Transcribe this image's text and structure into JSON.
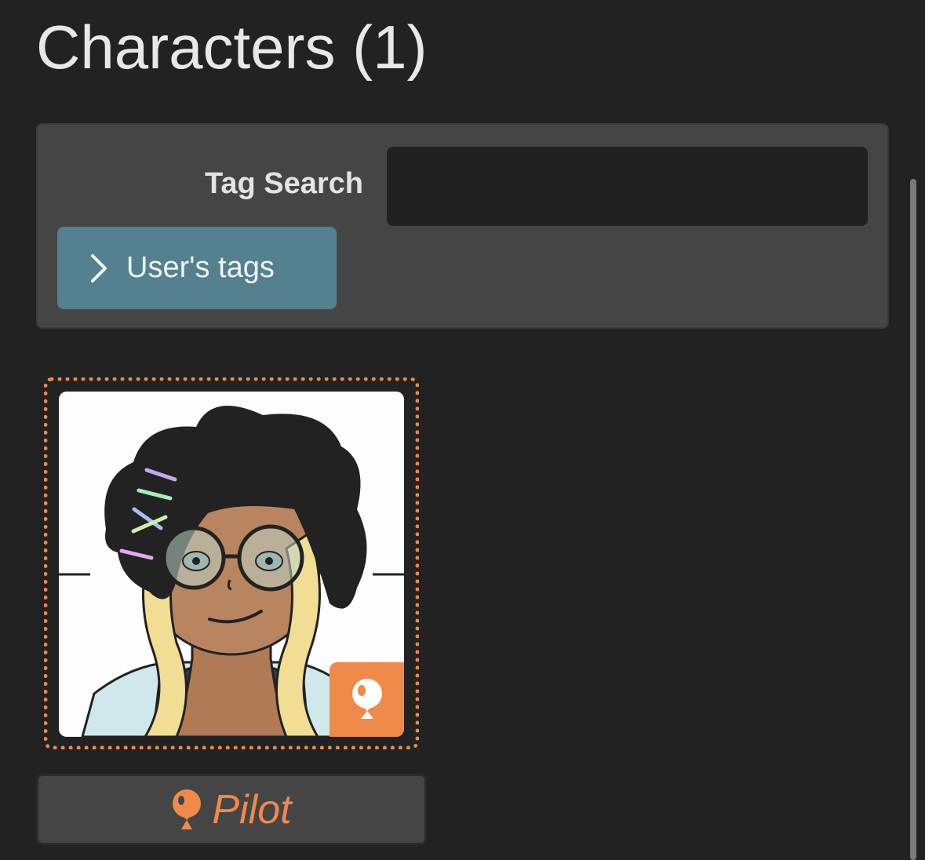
{
  "header": {
    "title": "Characters (1)"
  },
  "search": {
    "label": "Tag Search",
    "value": "",
    "users_tags_label": "User's tags"
  },
  "character": {
    "role_label": "Pilot",
    "role_icon": "balloon-icon"
  },
  "colors": {
    "background": "#222222",
    "panel": "#454545",
    "input": "#212121",
    "button_blue": "#55808f",
    "accent_orange": "#ef8a4a"
  }
}
